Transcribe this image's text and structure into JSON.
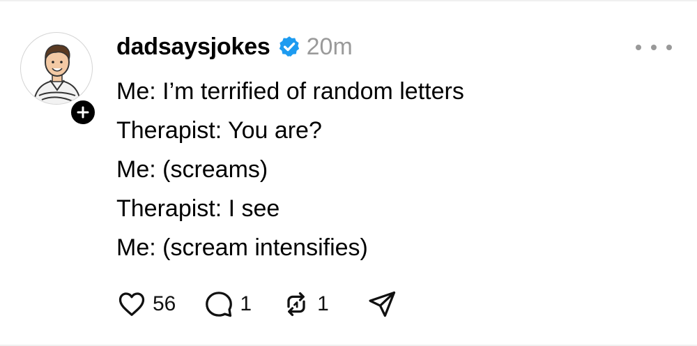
{
  "post": {
    "username": "dadsaysjokes",
    "verified": true,
    "timestamp": "20m",
    "lines": [
      "Me: I’m terrified of random letters",
      "Therapist: You are?",
      "Me: (screams)",
      "Therapist: I see",
      "Me: (scream intensifies)"
    ],
    "stats": {
      "likes": "56",
      "replies": "1",
      "reposts": "1"
    }
  },
  "icons": {
    "verified": "verified-badge-icon",
    "follow": "plus-icon",
    "more": "more-dots-icon",
    "like": "heart-icon",
    "reply": "comment-icon",
    "repost": "repost-icon",
    "share": "send-icon"
  },
  "colors": {
    "verified": "#1d9bf0",
    "muted": "#9a9a9a",
    "text": "#000000"
  }
}
